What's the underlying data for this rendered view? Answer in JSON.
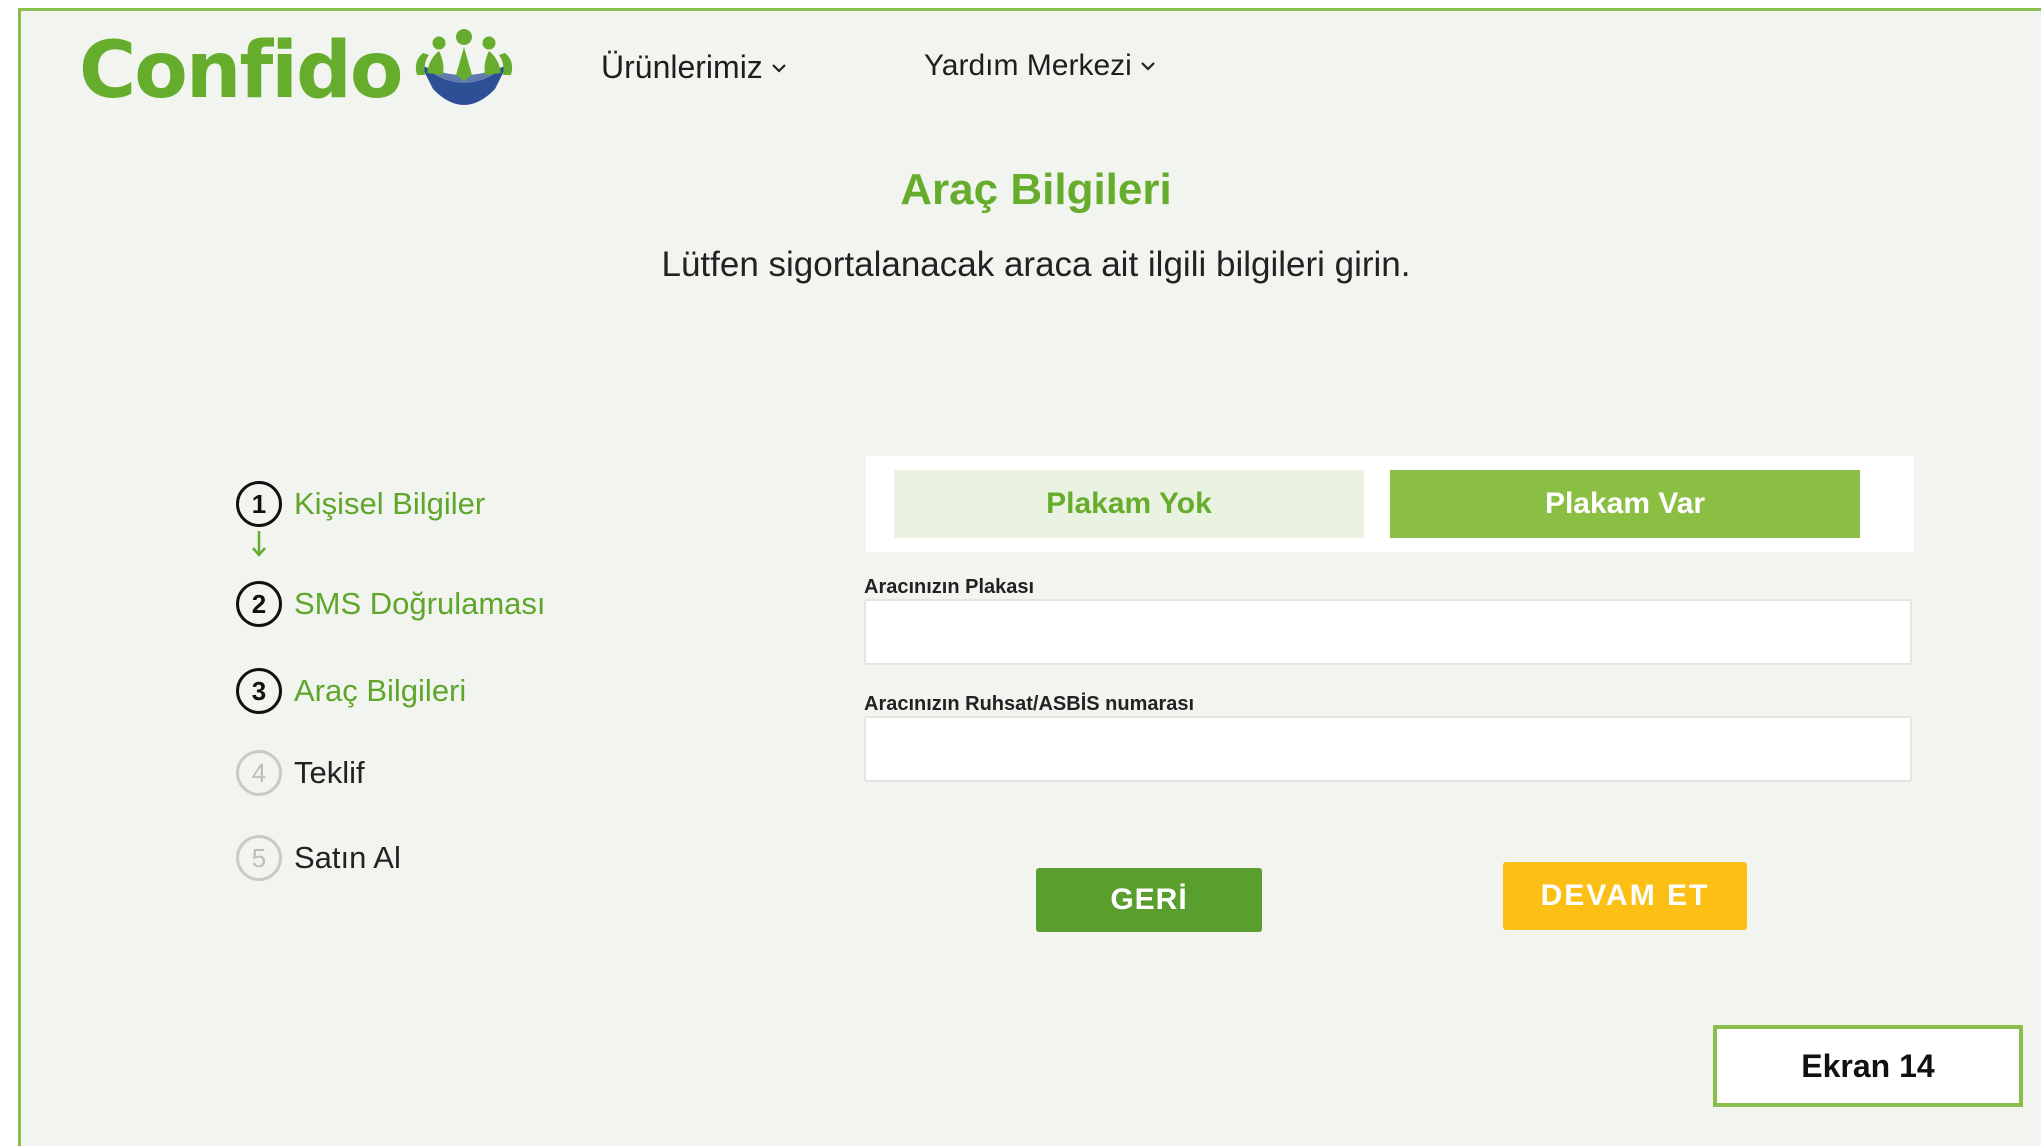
{
  "brand": {
    "name": "Confido",
    "logo_icon": "people-shield-icon",
    "color": "#67ad2d"
  },
  "nav": {
    "items": [
      {
        "label": "Ürünlerimiz",
        "icon": "chevron-down-icon"
      },
      {
        "label": "Yardım Merkezi",
        "icon": "chevron-down-icon"
      }
    ]
  },
  "page": {
    "title": "Araç Bilgileri",
    "subtitle": "Lütfen sigortalanacak araca ait ilgili bilgileri girin."
  },
  "steps": [
    {
      "number": "1",
      "label": "Kişisel Bilgiler",
      "state": "done"
    },
    {
      "number": "2",
      "label": "SMS Doğrulaması",
      "state": "done"
    },
    {
      "number": "3",
      "label": "Araç Bilgileri",
      "state": "current"
    },
    {
      "number": "4",
      "label": "Teklif",
      "state": "upcoming"
    },
    {
      "number": "5",
      "label": "Satın Al",
      "state": "upcoming"
    }
  ],
  "tabs": {
    "no_plate": "Plakam Yok",
    "has_plate": "Plakam Var",
    "selected": "Plakam Var"
  },
  "form": {
    "plate_label": "Aracınızın Plakası",
    "plate_value": "",
    "license_label": "Aracınızın Ruhsat/ASBİS numarası",
    "license_value": ""
  },
  "buttons": {
    "back": "GERİ",
    "next": "DEVAM ET"
  },
  "badge": "Ekran 14",
  "colors": {
    "accent_green": "#8bbf44",
    "dark_green": "#5a9e2e",
    "button_yellow": "#fbbf16",
    "background": "#f2f4ef"
  }
}
